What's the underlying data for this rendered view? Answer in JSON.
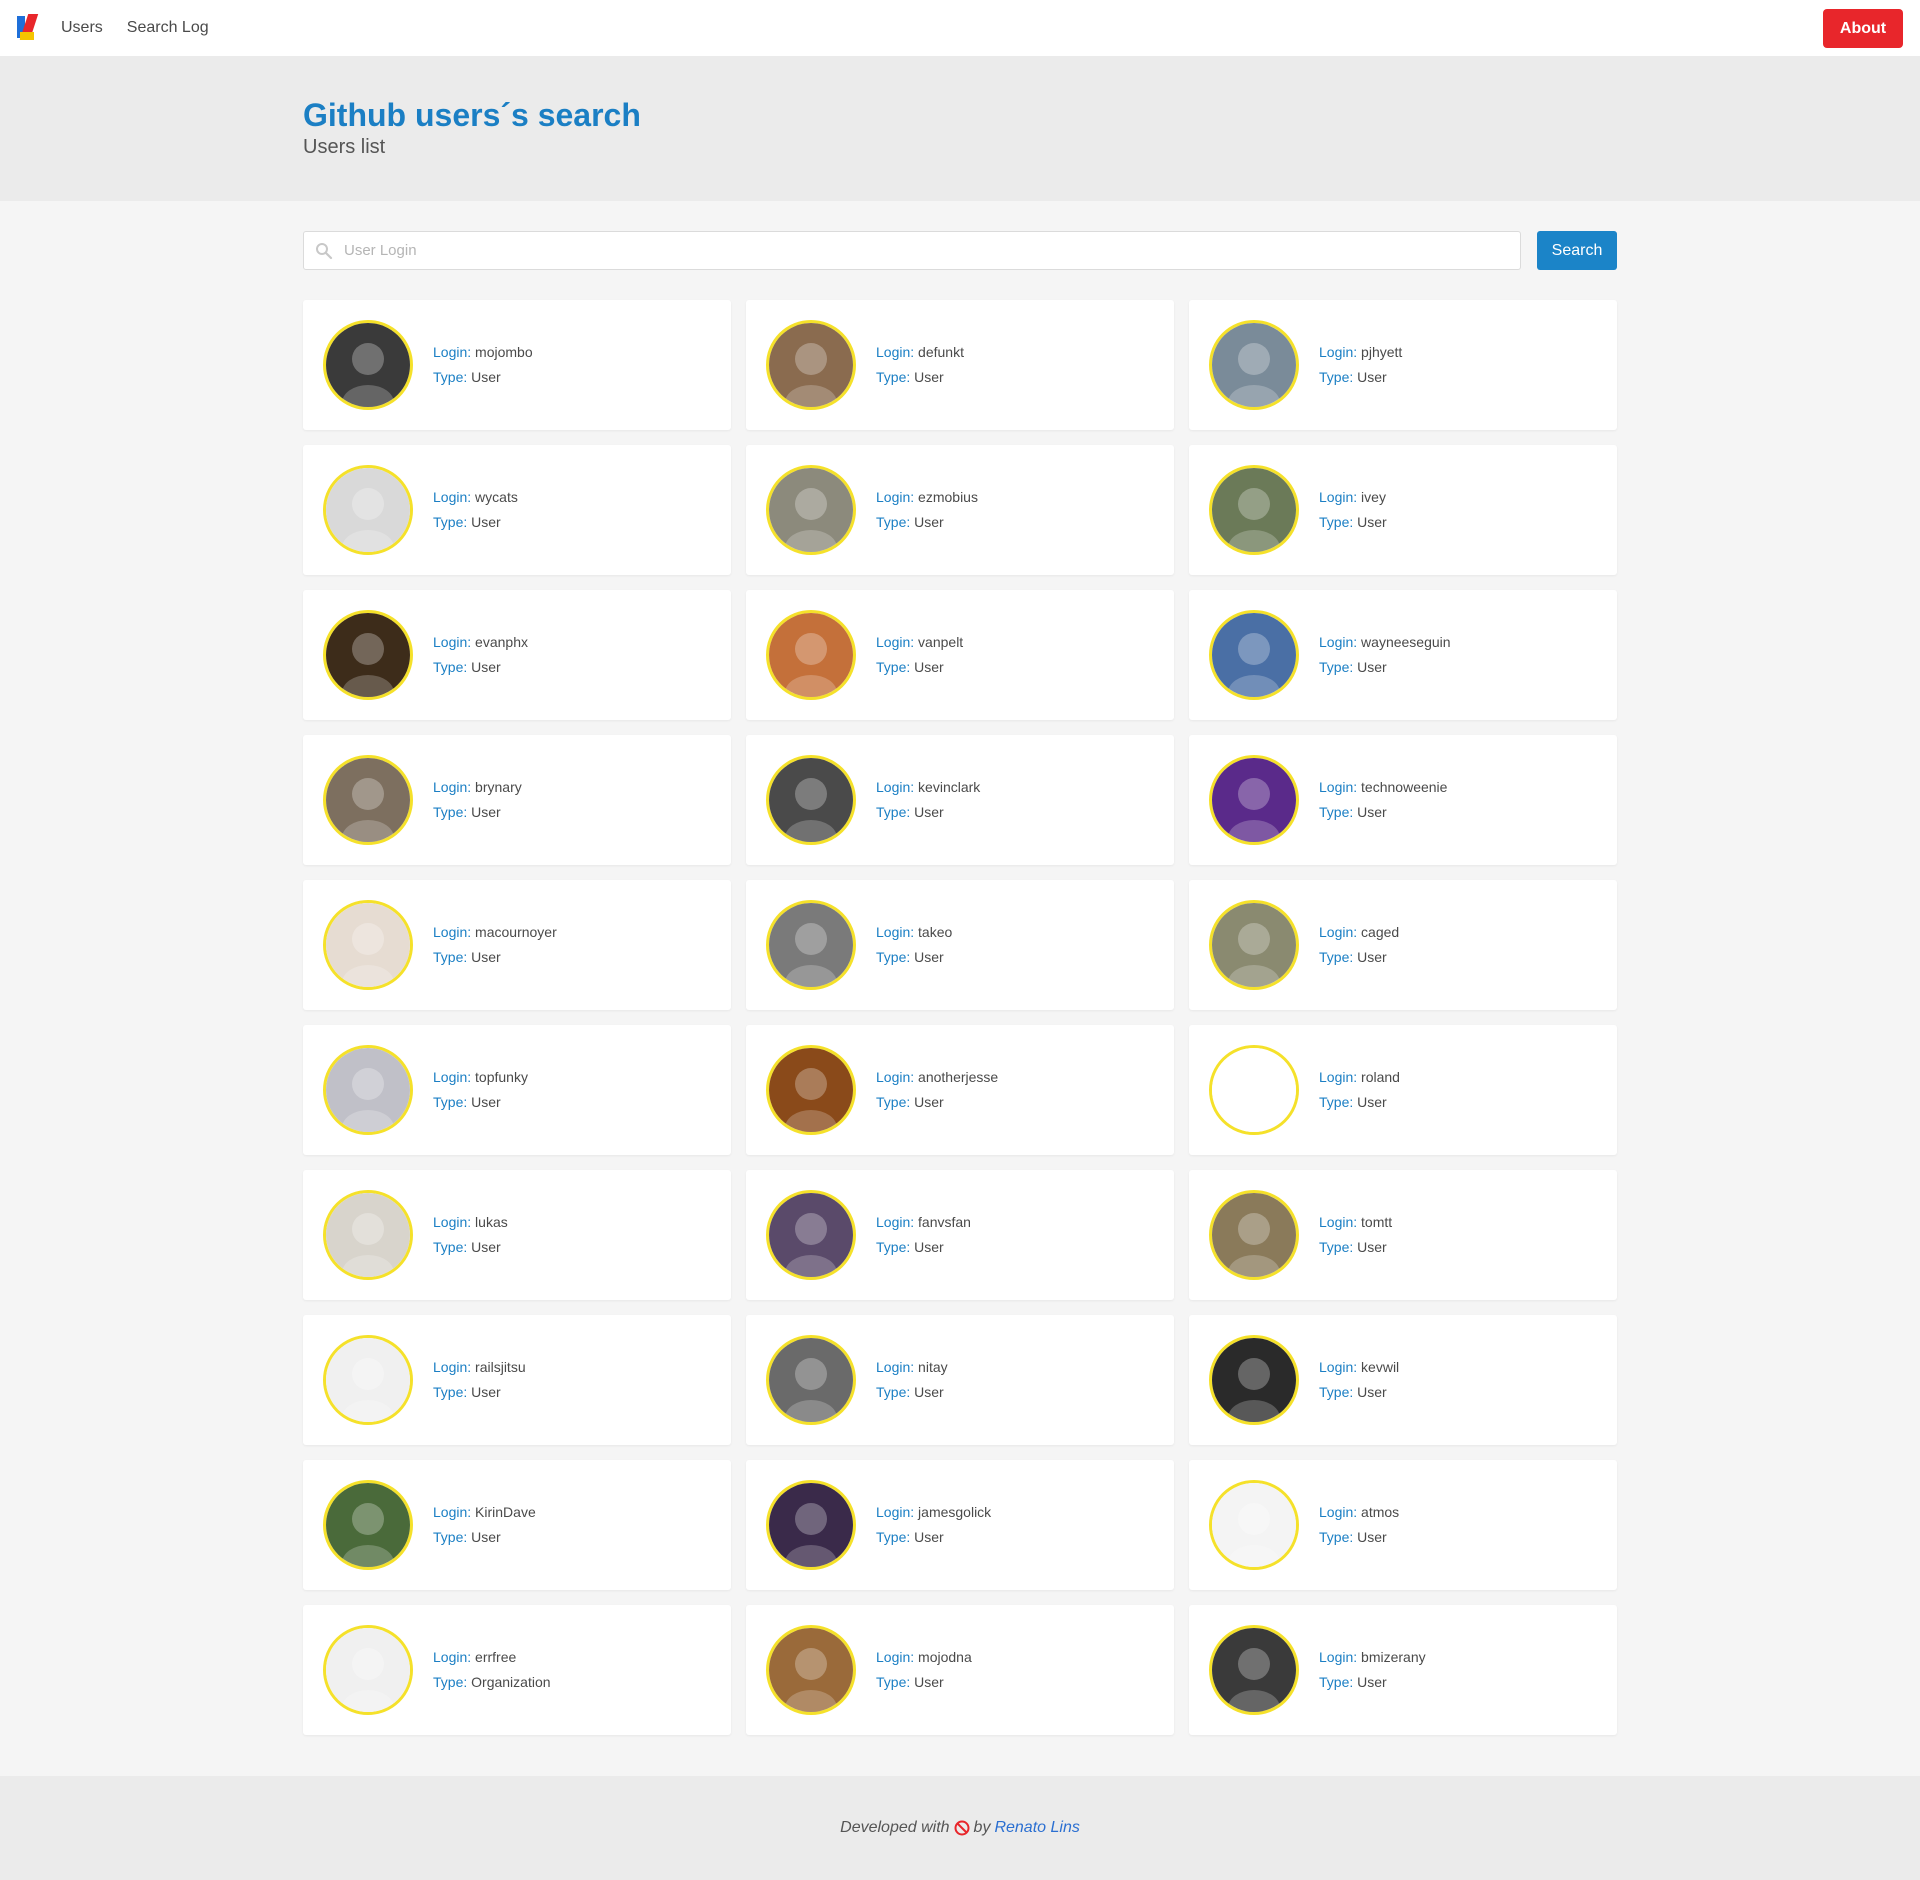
{
  "nav": {
    "items": [
      "Users",
      "Search Log"
    ],
    "about_label": "About"
  },
  "hero": {
    "title": "Github users´s search",
    "subtitle": "Users list"
  },
  "search": {
    "placeholder": "User Login",
    "value": "",
    "button_label": "Search"
  },
  "labels": {
    "login": "Login:",
    "type": "Type:"
  },
  "users": [
    {
      "login": "mojombo",
      "type": "User",
      "avatar": "#3a3a3a"
    },
    {
      "login": "defunkt",
      "type": "User",
      "avatar": "#8a6b4f"
    },
    {
      "login": "pjhyett",
      "type": "User",
      "avatar": "#7a8b99"
    },
    {
      "login": "wycats",
      "type": "User",
      "avatar": "#d9d9d9"
    },
    {
      "login": "ezmobius",
      "type": "User",
      "avatar": "#8c8a7c"
    },
    {
      "login": "ivey",
      "type": "User",
      "avatar": "#6b7a58"
    },
    {
      "login": "evanphx",
      "type": "User",
      "avatar": "#3d2c1a"
    },
    {
      "login": "vanpelt",
      "type": "User",
      "avatar": "#c4703a"
    },
    {
      "login": "wayneeseguin",
      "type": "User",
      "avatar": "#4a6fa5"
    },
    {
      "login": "brynary",
      "type": "User",
      "avatar": "#7d6f5f"
    },
    {
      "login": "kevinclark",
      "type": "User",
      "avatar": "#4a4a4a"
    },
    {
      "login": "technoweenie",
      "type": "User",
      "avatar": "#5a2a8a"
    },
    {
      "login": "macournoyer",
      "type": "User",
      "avatar": "#e6dcd2"
    },
    {
      "login": "takeo",
      "type": "User",
      "avatar": "#7a7a7a"
    },
    {
      "login": "caged",
      "type": "User",
      "avatar": "#8a8a70"
    },
    {
      "login": "topfunky",
      "type": "User",
      "avatar": "#c0c0c8"
    },
    {
      "login": "anotherjesse",
      "type": "User",
      "avatar": "#8a4a1a"
    },
    {
      "login": "roland",
      "type": "User",
      "avatar": "#ffffff"
    },
    {
      "login": "lukas",
      "type": "User",
      "avatar": "#d8d4cc"
    },
    {
      "login": "fanvsfan",
      "type": "User",
      "avatar": "#5a4a6a"
    },
    {
      "login": "tomtt",
      "type": "User",
      "avatar": "#8a7a5a"
    },
    {
      "login": "railsjitsu",
      "type": "User",
      "avatar": "#f0f0f0"
    },
    {
      "login": "nitay",
      "type": "User",
      "avatar": "#6a6a6a"
    },
    {
      "login": "kevwil",
      "type": "User",
      "avatar": "#2a2a2a"
    },
    {
      "login": "KirinDave",
      "type": "User",
      "avatar": "#4a6a3a"
    },
    {
      "login": "jamesgolick",
      "type": "User",
      "avatar": "#3a2a4a"
    },
    {
      "login": "atmos",
      "type": "User",
      "avatar": "#f4f4f4"
    },
    {
      "login": "errfree",
      "type": "Organization",
      "avatar": "#f0f0f0"
    },
    {
      "login": "mojodna",
      "type": "User",
      "avatar": "#9a6a3a"
    },
    {
      "login": "bmizerany",
      "type": "User",
      "avatar": "#3a3a3a"
    }
  ],
  "footer": {
    "prefix": "Developed with",
    "by": "by",
    "author": "Renato Lins"
  },
  "colors": {
    "accent": "#1b7fc4",
    "about_button": "#e8262b",
    "avatar_border": "#f5e12a"
  }
}
